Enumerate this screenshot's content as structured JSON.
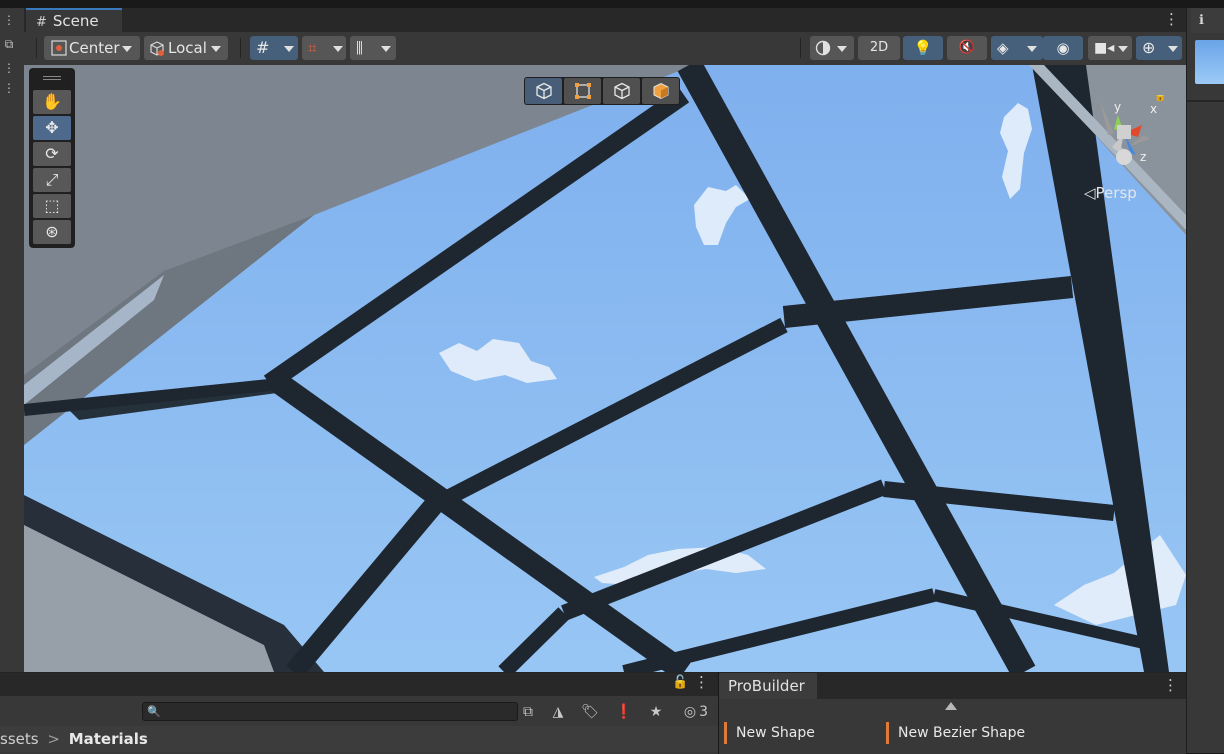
{
  "scene_tab": {
    "icon": "#",
    "label": "Scene"
  },
  "toolbar": {
    "pivot_position": "Center",
    "pivot_rotation": "Local",
    "toggle_2d": "2D"
  },
  "tools": [
    "hand-tool",
    "move-tool",
    "rotate-tool",
    "scale-tool",
    "rect-tool",
    "transform-tool"
  ],
  "scene_view": {
    "projection_label": "Persp",
    "gizmo_axes": {
      "x": "x",
      "y": "y",
      "z": "z"
    }
  },
  "project_panel": {
    "search_placeholder": "",
    "hidden_count": "3",
    "breadcrumb": {
      "parent": "ssets",
      "separator": ">",
      "current": "Materials"
    }
  },
  "probuilder": {
    "tab": "ProBuilder",
    "items": [
      "New Shape",
      "New Bezier Shape"
    ],
    "accent": "#e07a3a"
  },
  "colors": {
    "accent_blue": "#3a79bb",
    "sky": "#8ebcf1",
    "frame": "#1e2630"
  }
}
